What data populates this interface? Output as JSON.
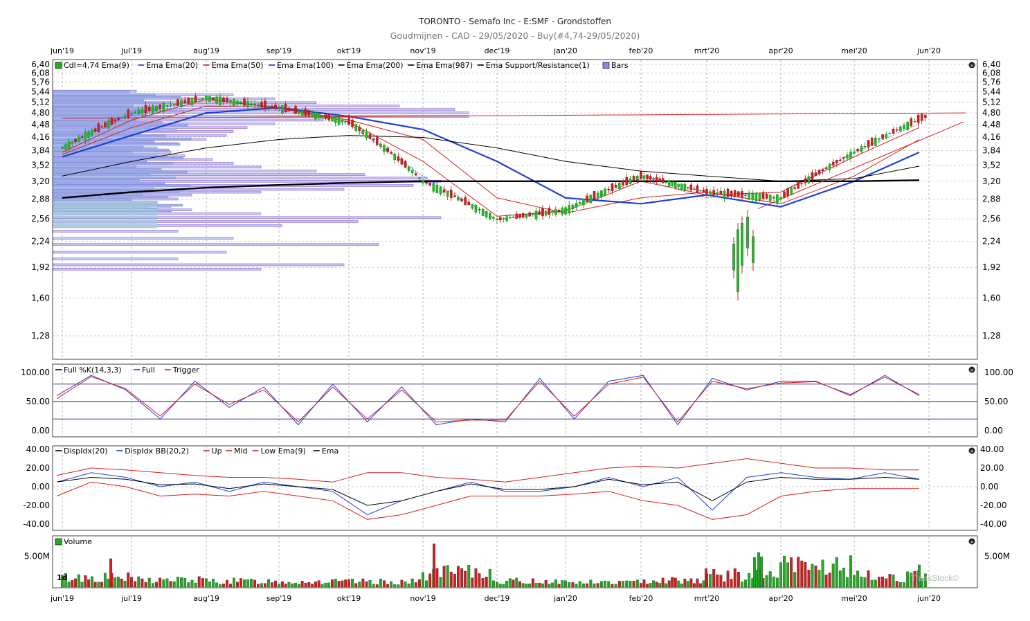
{
  "header": {
    "title": "TORONTO - Semafo Inc - E:SMF - Grondstoffen",
    "subtitle": "Goudmijnen - CAD - 29/05/2020 - Buy(#4,74-29/05/2020)"
  },
  "months": [
    "jun'19",
    "jul'19",
    "aug'19",
    "sep'19",
    "okt'19",
    "nov'19",
    "dec'19",
    "jan'20",
    "feb'20",
    "mrt'20",
    "apr'20",
    "mei'20",
    "jun'20"
  ],
  "panels": {
    "price": {
      "legend": [
        {
          "text": "Cdl=4,74  Ema(9)",
          "color": "#808080",
          "swatch": "#22aa22"
        },
        {
          "text": "Ema  Ema(20)",
          "color": "#1e3fd8"
        },
        {
          "text": "Ema  Ema(50)",
          "color": "#d82020"
        },
        {
          "text": "Ema  Ema(100)",
          "color": "#1e3fd8"
        },
        {
          "text": "Ema  Ema(200)",
          "color": "#000000"
        },
        {
          "text": "Ema  Ema(987)",
          "color": "#000000"
        },
        {
          "text": "Ema  Support/Resistance(1)",
          "color": "#000000"
        },
        {
          "text": "Bars",
          "color": "#7070e0",
          "swatch": "#8888ee"
        }
      ],
      "ticks": [
        "6,40",
        "6,08",
        "5,76",
        "5,44",
        "5,12",
        "4,80",
        "4,48",
        "4,16",
        "3,84",
        "3,52",
        "3,20",
        "2,88",
        "2,56",
        "2,24",
        "1,92",
        "1,60",
        "1,28"
      ]
    },
    "stoch": {
      "legend": [
        {
          "text": "Full %K(14,3,3)",
          "color": "#000000"
        },
        {
          "text": "Full",
          "color": "#1e3fd8"
        },
        {
          "text": "Trigger",
          "color": "#d82020"
        }
      ],
      "ticks": [
        "100.00",
        "50.00",
        "0.00"
      ]
    },
    "disp": {
      "legend": [
        {
          "text": "DispIdx(20)",
          "color": "#000000"
        },
        {
          "text": "DispIdx  BB(20,2)",
          "color": "#1e3fd8"
        },
        {
          "text": "Up",
          "color": "#d82020"
        },
        {
          "text": "Mid",
          "color": "#d82020"
        },
        {
          "text": "Low  Ema(9)",
          "color": "#d82020"
        },
        {
          "text": "Ema",
          "color": "#000000"
        }
      ],
      "ticks": [
        "40.00",
        "20.00",
        "0.00",
        "-20.00",
        "-40.00"
      ]
    },
    "volume": {
      "legend": [
        {
          "text": "Volume",
          "color": "#000000",
          "swatch": "#22aa22"
        }
      ],
      "ticks": [
        "5.00M"
      ],
      "overlay": "1d",
      "watermark": "TransStock©"
    }
  },
  "chart_data": [
    {
      "type": "candlestick",
      "title": "TORONTO - Semafo Inc - E:SMF - Grondstoffen",
      "subtitle": "Goudmijnen - CAD - 29/05/2020 - Buy(#4,74-29/05/2020)",
      "x": [
        "jun'19",
        "jul'19",
        "aug'19",
        "sep'19",
        "okt'19",
        "nov'19",
        "dec'19",
        "jan'20",
        "feb'20",
        "mrt'20",
        "apr'20",
        "mei'20",
        "jun'20"
      ],
      "ylim": [
        1.28,
        6.4
      ],
      "scale": "log",
      "close_by_month": [
        3.9,
        4.8,
        5.25,
        4.95,
        4.55,
        3.2,
        2.55,
        2.7,
        3.3,
        3.0,
        2.9,
        3.8,
        4.74
      ],
      "last_close": 4.74,
      "series": [
        {
          "name": "Ema(9)",
          "values": [
            3.9,
            4.75,
            5.25,
            4.9,
            4.5,
            3.3,
            2.55,
            2.7,
            3.25,
            2.9,
            3.0,
            3.8,
            4.5
          ]
        },
        {
          "name": "Ema(20)",
          "values": [
            3.8,
            4.6,
            5.2,
            4.95,
            4.55,
            3.6,
            2.6,
            2.68,
            3.2,
            2.95,
            3.0,
            3.7,
            4.4
          ]
        },
        {
          "name": "Ema(50)",
          "values": [
            3.75,
            4.4,
            5.0,
            4.95,
            4.6,
            4.1,
            2.9,
            2.65,
            2.9,
            3.0,
            2.8,
            3.3,
            4.1
          ]
        },
        {
          "name": "Ema(100)",
          "values": [
            3.7,
            4.2,
            4.8,
            4.95,
            4.7,
            4.35,
            3.6,
            2.9,
            2.8,
            2.95,
            2.75,
            3.2,
            3.8
          ]
        },
        {
          "name": "Ema(200)",
          "values": [
            3.3,
            3.6,
            3.9,
            4.1,
            4.2,
            4.15,
            3.9,
            3.6,
            3.4,
            3.3,
            3.2,
            3.25,
            3.5
          ]
        },
        {
          "name": "Ema(987)",
          "values": [
            2.9,
            3.0,
            3.08,
            3.13,
            3.17,
            3.2,
            3.2,
            3.2,
            3.2,
            3.2,
            3.2,
            3.2,
            3.22
          ]
        }
      ],
      "resistance_level": 4.8,
      "legend": "top-left",
      "grid": true
    },
    {
      "type": "line",
      "title": "Full %K(14,3,3)",
      "ylim": [
        0,
        100
      ],
      "reference_lines": [
        80,
        50,
        20
      ],
      "series": [
        {
          "name": "Full",
          "values": [
            60,
            95,
            70,
            20,
            85,
            40,
            75,
            10,
            80,
            15,
            75,
            10,
            20,
            15,
            90,
            20,
            85,
            95,
            10,
            90,
            70,
            85,
            85,
            60,
            95,
            60
          ]
        },
        {
          "name": "Trigger",
          "values": [
            55,
            93,
            72,
            25,
            80,
            45,
            70,
            15,
            75,
            20,
            70,
            15,
            18,
            18,
            85,
            25,
            80,
            92,
            15,
            85,
            72,
            82,
            84,
            62,
            92,
            62
          ]
        }
      ]
    },
    {
      "type": "line",
      "title": "DispIdx(20)",
      "ylim": [
        -40,
        40
      ],
      "series": [
        {
          "name": "DispIdx",
          "values": [
            5,
            15,
            10,
            0,
            5,
            -5,
            5,
            0,
            -5,
            -30,
            -15,
            -5,
            5,
            -5,
            -5,
            0,
            10,
            0,
            10,
            -25,
            10,
            15,
            10,
            8,
            15,
            8
          ]
        },
        {
          "name": "Up",
          "values": [
            12,
            20,
            18,
            15,
            12,
            10,
            10,
            8,
            5,
            15,
            15,
            10,
            8,
            5,
            10,
            15,
            20,
            22,
            20,
            25,
            30,
            25,
            20,
            20,
            18,
            18
          ]
        },
        {
          "name": "Low",
          "values": [
            -10,
            5,
            0,
            -10,
            -8,
            -10,
            -5,
            -10,
            -15,
            -35,
            -30,
            -20,
            -10,
            -10,
            -10,
            -8,
            -5,
            -15,
            -20,
            -35,
            -30,
            -10,
            -5,
            -2,
            -2,
            -2
          ]
        },
        {
          "name": "Ema",
          "values": [
            5,
            10,
            8,
            2,
            3,
            -2,
            3,
            0,
            -3,
            -20,
            -15,
            -5,
            3,
            -3,
            -3,
            0,
            8,
            2,
            5,
            -15,
            5,
            10,
            8,
            8,
            10,
            8
          ]
        }
      ]
    },
    {
      "type": "bar",
      "title": "Volume",
      "ytick": "5.00M",
      "categories": [
        "jun'19",
        "jul'19",
        "aug'19",
        "sep'19",
        "okt'19",
        "nov'19",
        "dec'19",
        "jan'20",
        "feb'20",
        "mrt'20",
        "apr'20",
        "mei'20",
        "jun'20"
      ],
      "values": [
        1.6,
        1.2,
        1.0,
        0.9,
        0.9,
        2.4,
        1.0,
        0.8,
        1.2,
        2.0,
        3.5,
        1.8,
        2.0
      ]
    }
  ]
}
